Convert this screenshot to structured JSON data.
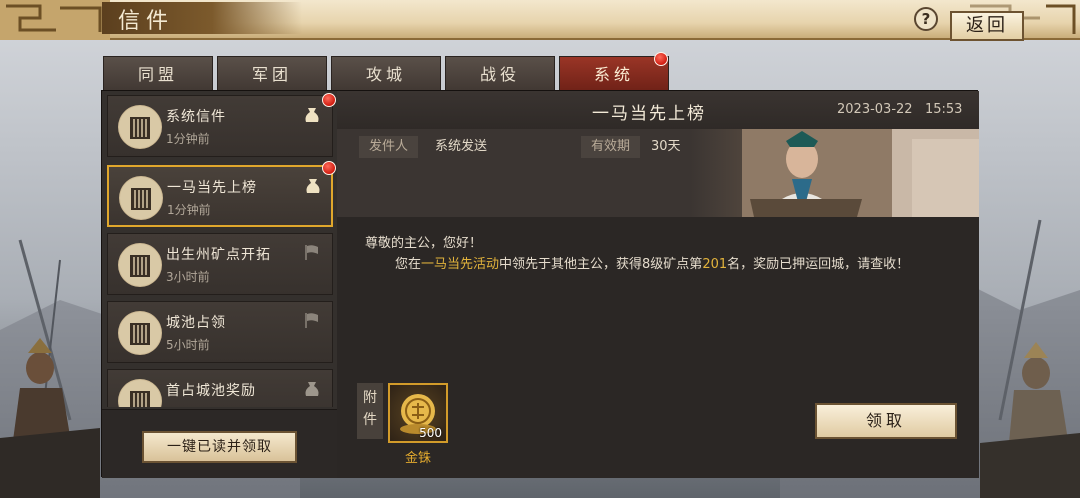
{
  "window": {
    "title": "信件",
    "help_label": "?",
    "back_label": "返回"
  },
  "tabs": [
    {
      "label": "同盟",
      "active": false
    },
    {
      "label": "军团",
      "active": false
    },
    {
      "label": "攻城",
      "active": false
    },
    {
      "label": "战役",
      "active": false
    },
    {
      "label": "系统",
      "active": true
    }
  ],
  "mail_list": [
    {
      "title": "系统信件",
      "time": "1分钟前",
      "unread": true,
      "has_attachment": true
    },
    {
      "title": "一马当先上榜",
      "time": "1分钟前",
      "unread": true,
      "has_attachment": true
    },
    {
      "title": "出生州矿点开拓",
      "time": "3小时前",
      "unread": false,
      "has_attachment": false
    },
    {
      "title": "城池占领",
      "time": "5小时前",
      "unread": false,
      "has_attachment": false
    },
    {
      "title": "首占城池奖励",
      "time": "",
      "unread": false,
      "has_attachment": true
    }
  ],
  "read_all_button": "一键已读并领取",
  "mail": {
    "subject": "一马当先上榜",
    "date": "2023-03-22",
    "time": "15:53",
    "sender_label": "发件人",
    "sender": "系统发送",
    "validity_label": "有效期",
    "validity": "30天",
    "greeting": "尊敬的主公，您好！",
    "body_1": "您在",
    "body_event": "一马当先活动",
    "body_2": "中领先于其他主公，获得8级矿点第",
    "body_rank": "201",
    "body_3": "名，奖励已押运回城，请查收！",
    "attachment_label": "附件",
    "attachment": {
      "name": "金铢",
      "quantity": "500"
    },
    "claim_button": "领取"
  },
  "colors": {
    "accent_gold": "#e2b33c",
    "active_tab": "#9a3526",
    "selected_border": "#e0a72c",
    "unread_dot": "#d01c10"
  }
}
